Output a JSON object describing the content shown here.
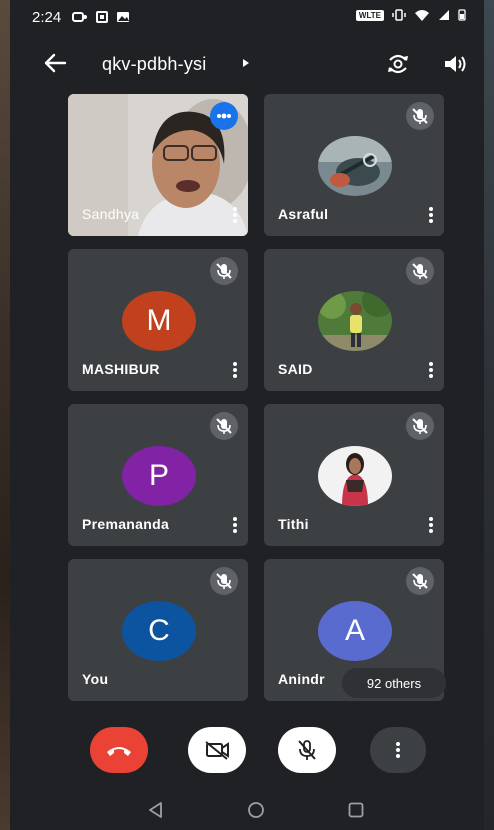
{
  "status_bar": {
    "time": "2:24",
    "network_badge": "WLTE"
  },
  "app_bar": {
    "meeting_code": "qkv-pdbh-ysi",
    "icons": [
      "back-arrow-icon",
      "chevron-right-icon",
      "rotate-camera-icon",
      "speaker-icon"
    ]
  },
  "participants": [
    {
      "name": "Sandhya",
      "type": "video",
      "muted": false,
      "speaking": true
    },
    {
      "name": "Asraful",
      "type": "photo",
      "muted": true
    },
    {
      "name": "MASHIBUR",
      "type": "initial",
      "initial": "M",
      "color": "#c1401d",
      "muted": true
    },
    {
      "name": "SAID",
      "type": "photo",
      "muted": true
    },
    {
      "name": "Premananda",
      "type": "initial",
      "initial": "P",
      "color": "#8222a5",
      "muted": true
    },
    {
      "name": "Tithi",
      "type": "photo",
      "muted": true
    },
    {
      "name": "You",
      "type": "initial",
      "initial": "C",
      "color": "#0c54a0",
      "muted": true
    },
    {
      "name": "Anindr",
      "type": "initial",
      "initial": "A",
      "color": "#5a6bd0",
      "muted": true
    }
  ],
  "others_badge": "92 others",
  "controls": {
    "end_call": {
      "color": "#ea4335",
      "icon": "end-call-icon"
    },
    "camera": {
      "state": "off",
      "icon": "camera-off-icon"
    },
    "mic": {
      "state": "off",
      "icon": "mic-off-icon"
    },
    "more": {
      "icon": "more-vert-icon"
    }
  },
  "nav": [
    "nav-back-icon",
    "nav-home-icon",
    "nav-recents-icon"
  ]
}
